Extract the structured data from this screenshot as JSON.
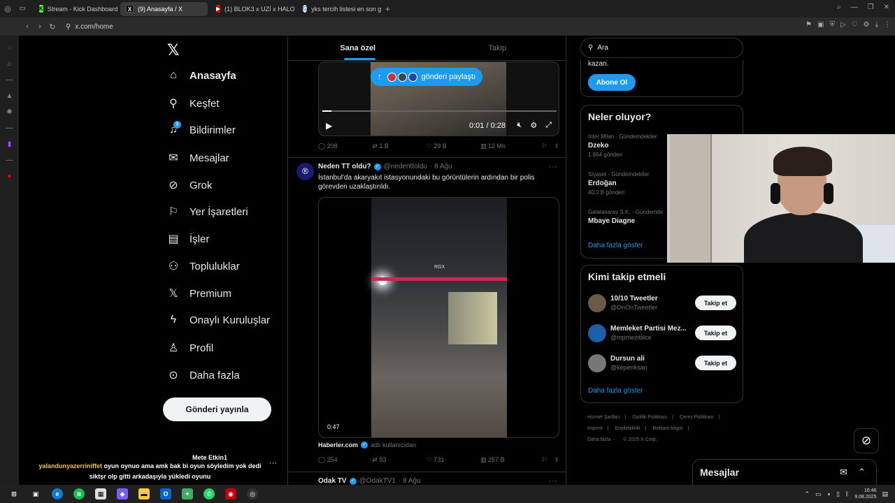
{
  "browser": {
    "tabs": [
      {
        "label": "Stream - Kick Dashboard",
        "active": false
      },
      {
        "label": "(9) Anasayfa / X",
        "active": true
      },
      {
        "label": "(1) BLOK3 x UZİ x HALOD",
        "active": false
      },
      {
        "label": "yks tercih listesi en son g",
        "active": false
      }
    ],
    "url": "x.com/home"
  },
  "nav": {
    "items": [
      {
        "label": "Anasayfa",
        "icon": "home-icon"
      },
      {
        "label": "Keşfet",
        "icon": "search-icon"
      },
      {
        "label": "Bildirimler",
        "icon": "bell-icon",
        "badge": "9"
      },
      {
        "label": "Mesajlar",
        "icon": "mail-icon"
      },
      {
        "label": "Grok",
        "icon": "grok-icon"
      },
      {
        "label": "Yer İşaretleri",
        "icon": "bookmark-icon"
      },
      {
        "label": "İşler",
        "icon": "briefcase-icon"
      },
      {
        "label": "Topluluklar",
        "icon": "people-icon"
      },
      {
        "label": "Premium",
        "icon": "x-icon"
      },
      {
        "label": "Onaylı Kuruluşlar",
        "icon": "lightning-icon"
      },
      {
        "label": "Profil",
        "icon": "person-icon"
      },
      {
        "label": "Daha fazla",
        "icon": "more-circle-icon"
      }
    ],
    "post_button": "Gönderi yayınla"
  },
  "feed": {
    "tabs": [
      "Sana özel",
      "Takip"
    ],
    "share_pill": "gönderi paylaştı",
    "video1": {
      "time": "0:01 / 0:28",
      "progress": 0.04
    },
    "tweet1_stats": {
      "replies": "208",
      "reposts": "1 B",
      "likes": "29 B",
      "views": "12 Mn"
    },
    "tweet2": {
      "avatar_letter": "®",
      "name": "Neden TT oldu?",
      "handle": "@nedenttoldu",
      "date": "· 8 Ağu",
      "text": "İstanbul'da akaryakıt istasyonundaki bu görüntülerin ardından bir polis görevden uzaklaştırıldı.",
      "duration": "0:47",
      "watermark": "RGX",
      "source_name": "Haberler.com",
      "source_note": "adlı kullanıcıdan",
      "stats": {
        "replies": "254",
        "reposts": "93",
        "likes": "731",
        "views": "257 B"
      }
    },
    "tweet3": {
      "name": "Odak TV",
      "handle": "@OdakTV1",
      "date": "· 8 Ağu"
    }
  },
  "right": {
    "search_placeholder": "Ara",
    "premium_text": "kazan.",
    "subscribe": "Abone Ol",
    "trends_title": "Neler oluyor?",
    "trends": [
      {
        "context": "Inter Milan · Gündemdekiler",
        "name": "Dzeko",
        "count": "1.864 gönderi"
      },
      {
        "context": "Siyaset · Gündemdekiler",
        "name": "Erdoğan",
        "count": "40,2 B gönderi"
      },
      {
        "context": "Galatasaray S.K. · Gündemde",
        "name": "Mbaye Diagne",
        "count": ""
      }
    ],
    "show_more": "Daha fazla göster",
    "who_title": "Kimi takip etmeli",
    "who": [
      {
        "name": "10/10 Tweetler",
        "handle": "@OnOnTweetler",
        "color": "#6b5a48"
      },
      {
        "name": "Memleket Partisi Mez...",
        "handle": "@mpmezitlilce",
        "color": "#1d5fa8"
      },
      {
        "name": "Dursun ali",
        "handle": "@kepenksan",
        "color": "#777777"
      }
    ],
    "follow": "Takip et",
    "footer": [
      "Hizmet Şartları",
      "|",
      "Gizlilik Politikası",
      "|",
      "Çerez Politikası",
      "|",
      "Imprint",
      "|",
      "Erişilebilirlik",
      "|",
      "Reklam bilgisi",
      "|",
      "Daha fazla ···",
      "© 2025 X Corp."
    ]
  },
  "messages_bar": "Mesajlar",
  "chat": {
    "top_user": "Mete Etkin1",
    "user": "yalandunyazerriniffet",
    "message_a": "oyun oynuo ama amk bak bi oyun söyledim yok dedi",
    "message_b": "siktşr olp gitti arkadaşıyla yükledi oyunu"
  },
  "taskbar": {
    "time": "16:46",
    "date": "9.08.2025"
  },
  "colors": {
    "accent": "#1d9bf0",
    "background": "#000000",
    "border": "#2f3336"
  }
}
